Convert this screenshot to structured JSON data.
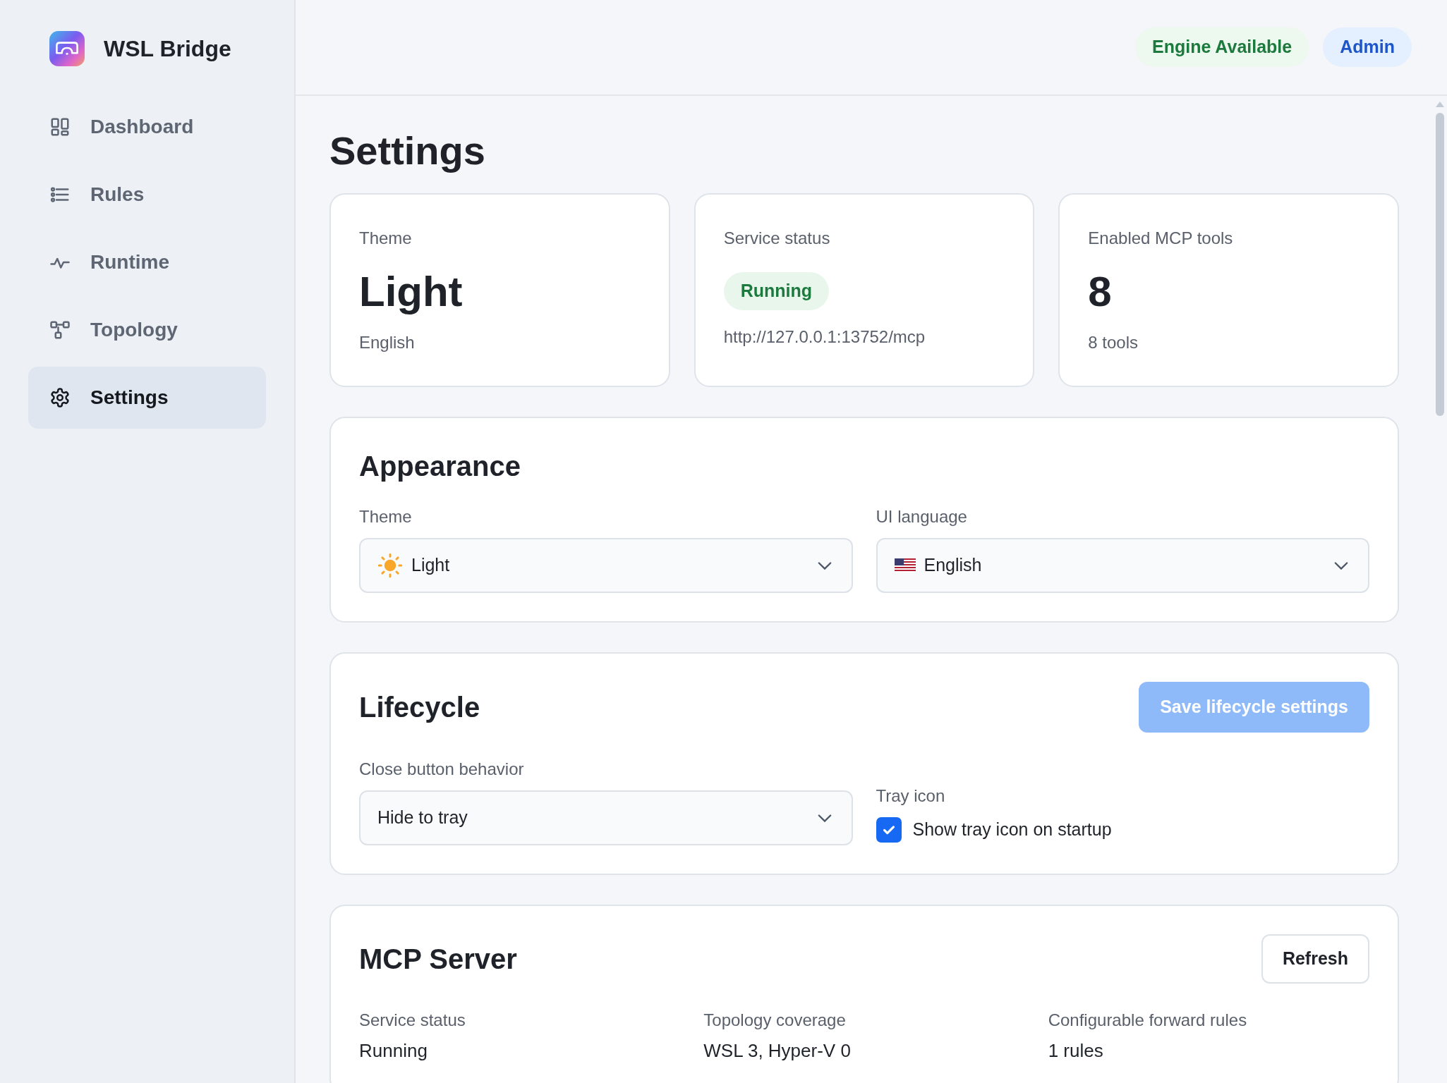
{
  "app": {
    "title": "WSL Bridge"
  },
  "sidebar": {
    "items": [
      {
        "label": "Dashboard",
        "selected": false
      },
      {
        "label": "Rules",
        "selected": false
      },
      {
        "label": "Runtime",
        "selected": false
      },
      {
        "label": "Topology",
        "selected": false
      },
      {
        "label": "Settings",
        "selected": true
      }
    ]
  },
  "header": {
    "badges": [
      {
        "label": "Engine Available",
        "kind": "success"
      },
      {
        "label": "Admin",
        "kind": "info"
      }
    ]
  },
  "page_title": "Settings",
  "stat_cards": [
    {
      "label": "Theme",
      "kind": "value",
      "value": "Light",
      "sub": "English"
    },
    {
      "label": "Service status",
      "kind": "badge",
      "value": "Running",
      "sub": "http://127.0.0.1:13752/mcp"
    },
    {
      "label": "Enabled MCP tools",
      "kind": "value",
      "value": "8",
      "sub": "8 tools"
    }
  ],
  "appearance": {
    "title": "Appearance",
    "fields": [
      {
        "label": "Theme",
        "value": "Light"
      },
      {
        "label": "UI language",
        "value": "English"
      }
    ]
  },
  "lifecycle": {
    "title": "Lifecycle",
    "save_button": {
      "label": "Save lifecycle settings",
      "disabled": true
    },
    "close_behavior": {
      "label": "Close button behavior",
      "value": "Hide to tray"
    },
    "tray": {
      "label": "Tray icon",
      "option": {
        "label": "Show tray icon on startup",
        "checked": true
      }
    }
  },
  "mcp_server": {
    "title": "MCP Server",
    "refresh_button": "Refresh",
    "stats": [
      {
        "label": "Service status",
        "value": "Running"
      },
      {
        "label": "Topology coverage",
        "value": "WSL 3, Hyper-V 0"
      },
      {
        "label": "Configurable forward rules",
        "value": "1 rules"
      }
    ]
  }
}
